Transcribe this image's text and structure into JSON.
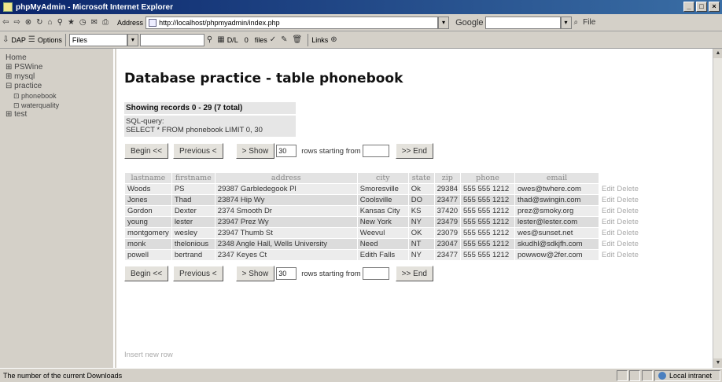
{
  "window": {
    "title": "phpMyAdmin - Microsoft Internet Explorer"
  },
  "toolbar": {
    "address_label": "Address",
    "address_url": "http://localhost/phpmyadmin/index.php",
    "google_label": "Google",
    "file_label": "File",
    "links_label": "Links",
    "dap_label": "DAP",
    "options_label": "Options",
    "files_label": "Files",
    "dl_label": "D/L",
    "dl_count": "0",
    "files_short": "files"
  },
  "sidebar": {
    "items": [
      {
        "label": "Home",
        "sub": false
      },
      {
        "label": "⊞ PSWine",
        "sub": false
      },
      {
        "label": "⊞ mysql",
        "sub": false
      },
      {
        "label": "⊟ practice",
        "sub": false
      },
      {
        "label": "⊡ phonebook",
        "sub": true
      },
      {
        "label": "⊡ waterquality",
        "sub": true
      },
      {
        "label": "⊞ test",
        "sub": false
      }
    ]
  },
  "main": {
    "title": "Database practice - table phonebook",
    "showing": "Showing records 0 - 29 (7 total)",
    "sql_label": "SQL-query:",
    "sql_query": "SELECT * FROM phonebook LIMIT 0, 30",
    "nav": {
      "begin": "Begin <<",
      "previous": "Previous <",
      "show": "> Show",
      "show_count": "30",
      "rows_label": "rows starting from",
      "end": ">> End"
    },
    "table": {
      "headers": [
        "lastname",
        "firstname",
        "address",
        "city",
        "state",
        "zip",
        "phone",
        "email"
      ],
      "rows": [
        [
          "Woods",
          "PS",
          "29387 Garbledegook Pl",
          "Smoresville",
          "Ok",
          "29384",
          "555 555 1212",
          "owes@twhere.com"
        ],
        [
          "Jones",
          "Thad",
          "23874 Hip Wy",
          "Coolsville",
          "DO",
          "23477",
          "555 555 1212",
          "thad@swingin.com"
        ],
        [
          "Gordon",
          "Dexter",
          "2374 Smooth Dr",
          "Kansas City",
          "KS",
          "37420",
          "555 555 1212",
          "prez@smoky.org"
        ],
        [
          "young",
          "lester",
          "23947 Prez Wy",
          "New York",
          "NY",
          "23479",
          "555 555 1212",
          "lester@lester.com"
        ],
        [
          "montgomery",
          "wesley",
          "23947 Thumb St",
          "Weevul",
          "OK",
          "23079",
          "555 555 1212",
          "wes@sunset.net"
        ],
        [
          "monk",
          "thelonious",
          "2348 Angle Hall, Wells University",
          "Need",
          "NT",
          "23047",
          "555 555 1212",
          "skudhl@sdkjfh.com"
        ],
        [
          "powell",
          "bertrand",
          "2347 Keyes Ct",
          "Edith Falls",
          "NY",
          "23477",
          "555 555 1212",
          "powwow@2fer.com"
        ]
      ],
      "edit_label": "Edit",
      "delete_label": "Delete"
    },
    "insert_new_row": "Insert new row"
  },
  "statusbar": {
    "text": "The number of the current Downloads",
    "zone": "Local intranet"
  }
}
